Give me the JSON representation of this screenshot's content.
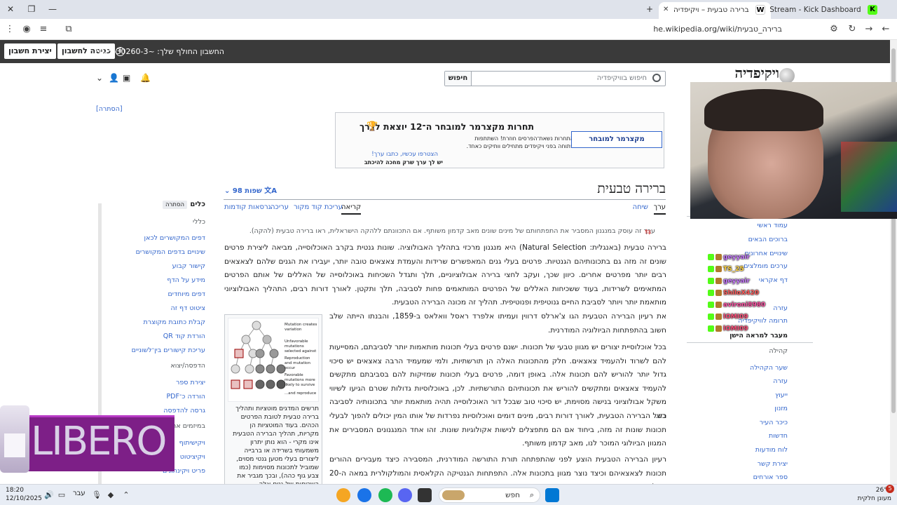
{
  "browser": {
    "tabs": [
      {
        "title": "ברירה טבעית – ויקיפדיה",
        "icon": "W"
      },
      {
        "title": "Stream - Kick Dashboard",
        "icon": "K"
      }
    ],
    "url": "he.wikipedia.org/wiki/ברירה_טבעית"
  },
  "personal": {
    "create_account": "יצירת חשבון",
    "login": "כניסה לחשבון",
    "ip_notice": "החשבון החולף שלך: ~2025-30260-3"
  },
  "header": {
    "search_button": "חיפוש",
    "search_placeholder": "חיפוש בוויקיפדיה",
    "logo": "ויקיפדיה",
    "hide": "[הסתרה]"
  },
  "banner": {
    "title": "תחרות מקצרמר למובחר ה־12 יוצאת לדרך",
    "text": "התחרות נשאת־הפרסים חוזרת! השתתפות פתוחה בפני ויקיפדים מתחילים וותיקים כאחד.",
    "logo": "מקצרמר למובחר",
    "link": "הצטרפו עכשיו, כתבו ערך!",
    "note": "יש לך ערך שרק מחכה להיכתב"
  },
  "article": {
    "title": "ברירה טבעית",
    "languages": "98 שפות",
    "tabs": [
      "ערך",
      "שיחה",
      "קריאה",
      "עריכת קוד מקור",
      "עריכה",
      "גרסאות קודמות"
    ],
    "hatnote": "ערך זה עוסק במנגנון המסביר את התפתחותם של מינים שונים מאב קדמון משותף. אם התכוונתם ללהקה הישראלית, ראו ברירה טבעית (להקה).",
    "paragraphs": [
      "ברירה טבעית (באנגלית: Natural Selection) היא מנגנון מרכזי בתהליך האבולוציה. שונות גנטית בקרב האוכלוסייה, מביאה ליצירת פרטים שונים זה מזה גם בתכונותיהם הגנטיות. פרטים בעלי גנים המאפשרים שרידות והעמדת צאצאים טובה יותר, יעבירו את הגנים שלהם לצאצאים רבים יותר מפרטים אחרים. כיוון שכך, ועקב לחצי ברירה אבולוציוניים, תלך ותגדל השכיחות באוכלוסייה של האללים של אותם הפרטים המתאימים לשרידות, בעוד ששכיחות האללים של הפרטים המותאמים פחות לסביבה, תלך ותקטן. לאורך דורות רבים, התהליך האבולוציוני מותאמת יותר ויותר לסביבת החיים גנוטיפית ופנוטיפית. תהליך זה מכונה הברירה הטבעית.",
      "את רעיון הברירה הטבעית הגו צ'ארלס דרווין ועמיתו אלפרד ראסל וואלאס ב-1859, והבנתו הייתה שלב חשוב בהתפתחות הביולוגיה המודרנית.",
      "בכל אוכלוסיית יצורים יש מגוון טבעי של תכונות. ישנם פרטים בעלי תכונות מותאמות יותר לסביבתם, המסייעות להם לשרוד ולהעמיד צאצאים. חלק מהתכונות האלה הן תורשתיות, ולמי שמעמיד הרבה צאצאים יש סיכוי גדול יותר להוריש להם תכונות אלה. באופן דומה, פרטים בעלי תכונות שמזיקות להם בסביבתם מתקשים להעמיד צאצאים ומתקשים להוריש את תכונותיהם התורשתיות. לכן, באוכלוסיות גדולות שטרם הגיעו לשיווי משקל אבולוציוני בנישה מסוימת, יש סיכוי טוב שבכל דור האוכלוסייה תהיה מותאמת יותר בתכונותיה לסביבה כזו.",
      "בשל הברירה הטבעית, לאורך דורות רבים, מינים דומים ואוכלוסיות נפרדות של אותו המין יכולים להפוך לבעלי תכונות שונות זה מזה, ביחוד אם הם מתפצלים לנישות אקולוגיות שונות. זהו אחד המנגנונים המסבירים את המגוון הביולוגי המוכר לנו, מאב קדמון משותף.",
      "רעיון הברירה הטבעית הוצע לפני שהתפתחה תורת התורשה המודרנית, המסבירה כיצד מעבירים ההורים תכונות לצאצאיהם וכיצד נוצר מגוון בתכונות אלה. התפתחות הגנטיקה הקלאסית והמולקולרית במאה ה-20 השלימו את"
    ],
    "thumb_caption": "תרשים המדגים מוטציות ותהליך ברירה טבעית לטובת הפרטים הכהים. בעוד המוטציות הן מקריות, תהליך הברירה הטבעית אינו מקרי - הוא נותן יתרון משמעותי בשרידה או ברבייה ליצורים בעלי מטען גנטי מסוים, שמוביל לתכונות מסוימות (כמו צבע גוף כהה), ובכך מגביר את השכיחות של גנים אלה באוכלוסייה.",
    "thumb_labels": [
      "Mutation creates variation",
      "Unfavorable mutations selected against",
      "Reproduction and mutation occur",
      "Favorable mutations more likely to survive",
      "...and reproduce"
    ]
  },
  "tools": {
    "heading": "כלים",
    "hide": "הסתרה",
    "items": [
      "כללי",
      "דפים המקושרים לכאן",
      "שינויים בדפים המקושרים",
      "קישור קבוע",
      "מידע על הדף",
      "דפים מיוחדים",
      "ציטוט דף זה",
      "קבלת כתובת מקוצרת",
      "הורדת קוד QR",
      "עריכת קישורים בין־לשוניים",
      "הדפסה/יצוא",
      "יצירת ספר",
      "הורדה כ־PDF",
      "גרסה להדפסה",
      "במיזמים אחרים",
      "ויקישיתוף",
      "ויקיציטוט",
      "פריט ויקינתונים"
    ]
  },
  "rnav": {
    "items": [
      "עמוד ראשי",
      "ברוכים הבאים",
      "שינויים אחרונים",
      "ערכים מומלצים",
      "דף אקראי",
      "עזרה",
      "תרומה לוויקיפדיה"
    ],
    "classic": "מעבר למראה הישן",
    "section_title": "קהילה",
    "community": [
      "שער הקהילה",
      "עזרה",
      "ייעוץ",
      "מזנון",
      "כיכר העיר",
      "חדשות",
      "לוח מודעות",
      "יצירת קשר",
      "ספר אורחים"
    ]
  },
  "chat": [
    {
      "user": "geyyair"
    },
    {
      "user": "TS_25"
    },
    {
      "user": "geyyair"
    },
    {
      "user": "ShiloX420"
    },
    {
      "user": "avironi8980"
    },
    {
      "user": "lOMI09"
    },
    {
      "user": "lOMI09"
    }
  ],
  "overlay": {
    "brand": "LIBERO"
  },
  "taskbar": {
    "time": "18:20",
    "date": "12/10/2025",
    "lang": "עבר",
    "search": "חפש",
    "temp": "26°C",
    "weather": "מעונן חלקית",
    "badge": "5"
  }
}
